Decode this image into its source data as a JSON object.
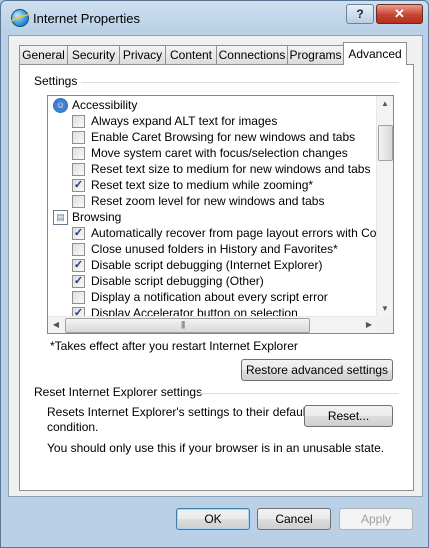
{
  "window": {
    "title": "Internet Properties",
    "help_label": "?",
    "close_label": "✕"
  },
  "tabs": [
    {
      "label": "General"
    },
    {
      "label": "Security"
    },
    {
      "label": "Privacy"
    },
    {
      "label": "Content"
    },
    {
      "label": "Connections"
    },
    {
      "label": "Programs"
    },
    {
      "label": "Advanced",
      "active": true
    }
  ],
  "settings": {
    "group_label": "Settings",
    "categories": [
      {
        "label": "Accessibility",
        "icon": "accessibility-icon"
      },
      {
        "label": "Browsing",
        "icon": "browsing-icon"
      }
    ],
    "items": [
      {
        "label": "Always expand ALT text for images",
        "checked": false
      },
      {
        "label": "Enable Caret Browsing for new windows and tabs",
        "checked": false
      },
      {
        "label": "Move system caret with focus/selection changes",
        "checked": false
      },
      {
        "label": "Reset text size to medium for new windows and tabs",
        "checked": false
      },
      {
        "label": "Reset text size to medium while zooming*",
        "checked": true
      },
      {
        "label": "Reset zoom level for new windows and tabs",
        "checked": false
      },
      {
        "label": "Automatically recover from page layout errors with Compa",
        "checked": true
      },
      {
        "label": "Close unused folders in History and Favorites*",
        "checked": false
      },
      {
        "label": "Disable script debugging (Internet Explorer)",
        "checked": true
      },
      {
        "label": "Disable script debugging (Other)",
        "checked": true
      },
      {
        "label": "Display a notification about every script error",
        "checked": false
      },
      {
        "label": "Display Accelerator button on selection",
        "checked": true
      }
    ],
    "footnote": "*Takes effect after you restart Internet Explorer",
    "restore_button": "Restore advanced settings"
  },
  "reset": {
    "group_label": "Reset Internet Explorer settings",
    "description_line1": "Resets Internet Explorer's settings to their default",
    "description_line2": "condition.",
    "reset_button": "Reset...",
    "warning": "You should only use this if your browser is in an unusable state."
  },
  "footer": {
    "ok": "OK",
    "cancel": "Cancel",
    "apply": "Apply"
  }
}
